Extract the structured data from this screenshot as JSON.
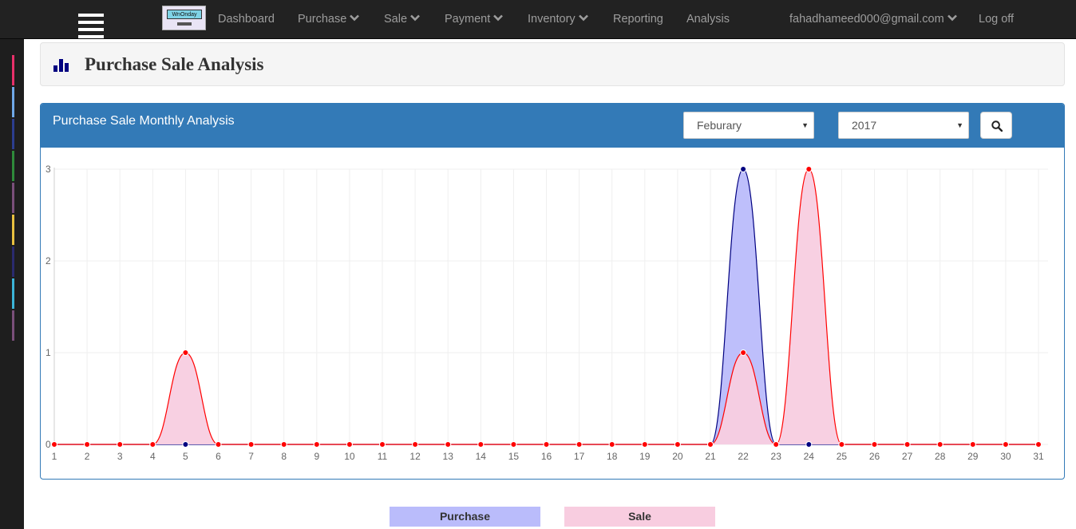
{
  "navbar": {
    "logo_text": "WnOnday",
    "items": [
      {
        "label": "Dashboard",
        "dropdown": false
      },
      {
        "label": "Purchase",
        "dropdown": true
      },
      {
        "label": "Sale",
        "dropdown": true
      },
      {
        "label": "Payment",
        "dropdown": true
      },
      {
        "label": "Inventory",
        "dropdown": true
      },
      {
        "label": "Reporting",
        "dropdown": false
      },
      {
        "label": "Analysis",
        "dropdown": false
      }
    ],
    "user_email": "fahadhameed000@gmail.com",
    "logoff_label": "Log off",
    "text_color": "#9d9d9d",
    "background": "#222222"
  },
  "sidebar": {
    "strip_colors": [
      "#e8306a",
      "#6fa8e8",
      "#2c3e8f",
      "#2e8b3a",
      "#7a4f7a",
      "#e8c040",
      "#2a2a6e",
      "#3bb4d8",
      "#7a4f7a"
    ]
  },
  "page_header": {
    "icon": "bar-chart-icon",
    "title": "Purchase Sale Analysis"
  },
  "panel": {
    "title": "Purchase Sale Monthly Analysis",
    "month_select": {
      "value": "Feburary"
    },
    "year_select": {
      "value": "2017"
    },
    "search_icon": "search-icon",
    "header_color": "#337ab7"
  },
  "chart_data": {
    "type": "area",
    "x": [
      1,
      2,
      3,
      4,
      5,
      6,
      7,
      8,
      9,
      10,
      11,
      12,
      13,
      14,
      15,
      16,
      17,
      18,
      19,
      20,
      21,
      22,
      23,
      24,
      25,
      26,
      27,
      28,
      29,
      30,
      31
    ],
    "ylim": [
      0,
      3
    ],
    "yticks": [
      0,
      1,
      2,
      3
    ],
    "grid": true,
    "legend_position": "bottom",
    "series": [
      {
        "name": "Purchase",
        "color": "#000080",
        "fill": "#babcfb",
        "values": [
          0,
          0,
          0,
          0,
          0,
          0,
          0,
          0,
          0,
          0,
          0,
          0,
          0,
          0,
          0,
          0,
          0,
          0,
          0,
          0,
          0,
          3,
          0,
          0,
          0,
          0,
          0,
          0,
          0,
          0,
          0
        ]
      },
      {
        "name": "Sale",
        "color": "#ff0000",
        "fill": "#f8cde0",
        "values": [
          0,
          0,
          0,
          0,
          1,
          0,
          0,
          0,
          0,
          0,
          0,
          0,
          0,
          0,
          0,
          0,
          0,
          0,
          0,
          0,
          0,
          1,
          0,
          3,
          0,
          0,
          0,
          0,
          0,
          0,
          0
        ]
      }
    ]
  }
}
